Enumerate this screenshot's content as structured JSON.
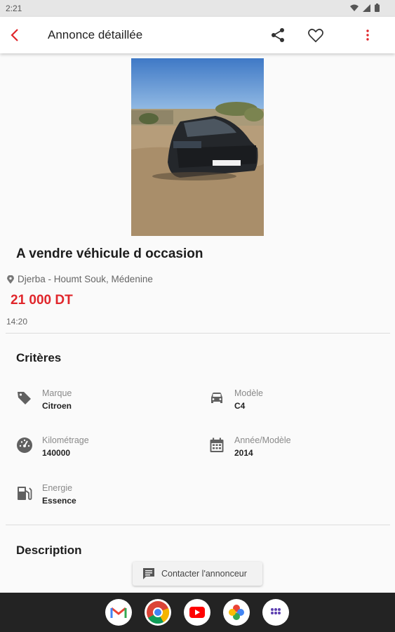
{
  "status_bar": {
    "time": "2:21"
  },
  "header": {
    "title": "Annonce détaillée"
  },
  "listing": {
    "title": "A vendre véhicule d occasion",
    "location": "Djerba - Houmt Souk, Médenine",
    "price": "21 000 DT",
    "time": "14:20"
  },
  "criteria": {
    "section_title": "Critères",
    "items": [
      {
        "label": "Marque",
        "value": "Citroen",
        "icon": "tag-icon"
      },
      {
        "label": "Modèle",
        "value": "C4",
        "icon": "car-icon"
      },
      {
        "label": "Kilométrage",
        "value": "140000",
        "icon": "speedometer-icon"
      },
      {
        "label": "Année/Modèle",
        "value": "2014",
        "icon": "calendar-icon"
      },
      {
        "label": "Energie",
        "value": "Essence",
        "icon": "fuel-pump-icon"
      }
    ]
  },
  "description": {
    "title": "Description"
  },
  "contact": {
    "label": "Contacter l'annonceur"
  },
  "dock": {
    "apps": [
      "gmail-icon",
      "chrome-icon",
      "youtube-icon",
      "photos-icon",
      "app-drawer-icon"
    ]
  },
  "colors": {
    "accent": "#e0262b",
    "dock_bg": "#232323"
  }
}
